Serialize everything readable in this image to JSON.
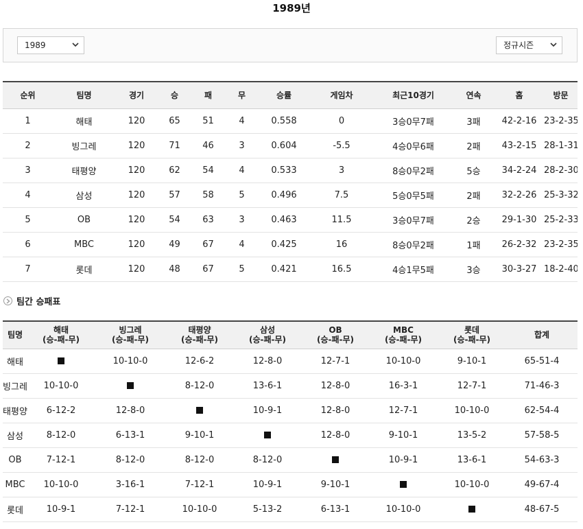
{
  "page": {
    "title": "1989년"
  },
  "filters": {
    "year": {
      "value": "1989"
    },
    "season": {
      "value": "정규시즌"
    }
  },
  "standings": {
    "headers": [
      "순위",
      "팀명",
      "경기",
      "승",
      "패",
      "무",
      "승률",
      "게임차",
      "최근10경기",
      "연속",
      "홈",
      "방문"
    ],
    "rows": [
      [
        "1",
        "해태",
        "120",
        "65",
        "51",
        "4",
        "0.558",
        "0",
        "3승0무7패",
        "3패",
        "42-2-16",
        "23-2-35"
      ],
      [
        "2",
        "빙그레",
        "120",
        "71",
        "46",
        "3",
        "0.604",
        "-5.5",
        "4승0무6패",
        "2패",
        "43-2-15",
        "28-1-31"
      ],
      [
        "3",
        "태평양",
        "120",
        "62",
        "54",
        "4",
        "0.533",
        "3",
        "8승0무2패",
        "5승",
        "34-2-24",
        "28-2-30"
      ],
      [
        "4",
        "삼성",
        "120",
        "57",
        "58",
        "5",
        "0.496",
        "7.5",
        "5승0무5패",
        "2패",
        "32-2-26",
        "25-3-32"
      ],
      [
        "5",
        "OB",
        "120",
        "54",
        "63",
        "3",
        "0.463",
        "11.5",
        "3승0무7패",
        "2승",
        "29-1-30",
        "25-2-33"
      ],
      [
        "6",
        "MBC",
        "120",
        "49",
        "67",
        "4",
        "0.425",
        "16",
        "8승0무2패",
        "1패",
        "26-2-32",
        "23-2-35"
      ],
      [
        "7",
        "롯데",
        "120",
        "48",
        "67",
        "5",
        "0.421",
        "16.5",
        "4승1무5패",
        "3승",
        "30-3-27",
        "18-2-40"
      ]
    ]
  },
  "head_to_head": {
    "title": "팀간 승패표",
    "first_header": "팀명",
    "sub_label": "(승-패-무)",
    "teams": [
      "해태",
      "빙그레",
      "태평양",
      "삼성",
      "OB",
      "MBC",
      "롯데"
    ],
    "total_header": "합계",
    "rows": [
      {
        "team": "해태",
        "cells": [
          "■",
          "10-10-0",
          "12-6-2",
          "12-8-0",
          "12-7-1",
          "10-10-0",
          "9-10-1"
        ],
        "total": "65-51-4"
      },
      {
        "team": "빙그레",
        "cells": [
          "10-10-0",
          "■",
          "8-12-0",
          "13-6-1",
          "12-8-0",
          "16-3-1",
          "12-7-1"
        ],
        "total": "71-46-3"
      },
      {
        "team": "태평양",
        "cells": [
          "6-12-2",
          "12-8-0",
          "■",
          "10-9-1",
          "12-8-0",
          "12-7-1",
          "10-10-0"
        ],
        "total": "62-54-4"
      },
      {
        "team": "삼성",
        "cells": [
          "8-12-0",
          "6-13-1",
          "9-10-1",
          "■",
          "12-8-0",
          "9-10-1",
          "13-5-2"
        ],
        "total": "57-58-5"
      },
      {
        "team": "OB",
        "cells": [
          "7-12-1",
          "8-12-0",
          "8-12-0",
          "8-12-0",
          "■",
          "10-9-1",
          "13-6-1"
        ],
        "total": "54-63-3"
      },
      {
        "team": "MBC",
        "cells": [
          "10-10-0",
          "3-16-1",
          "7-12-1",
          "10-9-1",
          "9-10-1",
          "■",
          "10-10-0"
        ],
        "total": "49-67-4"
      },
      {
        "team": "롯데",
        "cells": [
          "10-9-1",
          "7-12-1",
          "10-10-0",
          "5-13-2",
          "6-13-1",
          "10-10-0",
          "■"
        ],
        "total": "48-67-5"
      }
    ]
  },
  "icons": {
    "select_arrow": "chevron-down-icon",
    "section_bullet": "circle-arrow-right-icon"
  }
}
